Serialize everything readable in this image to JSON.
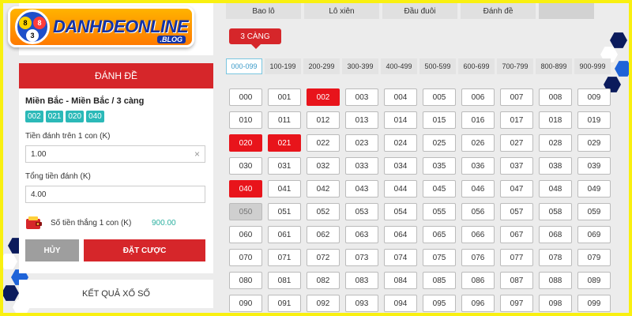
{
  "logo": {
    "text": "DANHDEONLINE",
    "sub": ".BLOG",
    "balls": [
      "8",
      "8",
      "3"
    ]
  },
  "form": {
    "header": "ĐÁNH ĐỀ",
    "bet_type": "Miền Bắc - Miền Bắc / 3 càng",
    "chips": [
      "002",
      "021",
      "020",
      "040"
    ],
    "amount_label": "Tiền đánh trên 1 con (K)",
    "amount_value": "1.00",
    "clear_symbol": "×",
    "total_label": "Tổng tiền đánh (K)",
    "total_value": "4.00",
    "win_label": "Số tiền thắng 1 con (K)",
    "win_value": "900.00",
    "cancel_label": "HỦY",
    "bet_label": "ĐẶT CƯỢC"
  },
  "results_label": "KẾT QUẢ XỔ SỐ",
  "tabs": [
    "Bao lô",
    "Lô xiên",
    "Đầu đuôi",
    "Đánh đề"
  ],
  "three_tag": "3 CÀNG",
  "ranges": [
    "000-099",
    "100-199",
    "200-299",
    "300-399",
    "400-499",
    "500-599",
    "600-699",
    "700-799",
    "800-899",
    "900-999"
  ],
  "active_range": 0,
  "numbers": [
    "000",
    "001",
    "002",
    "003",
    "004",
    "005",
    "006",
    "007",
    "008",
    "009",
    "010",
    "011",
    "012",
    "013",
    "014",
    "015",
    "016",
    "017",
    "018",
    "019",
    "020",
    "021",
    "022",
    "023",
    "024",
    "025",
    "026",
    "027",
    "028",
    "029",
    "030",
    "031",
    "032",
    "033",
    "034",
    "035",
    "036",
    "037",
    "038",
    "039",
    "040",
    "041",
    "042",
    "043",
    "044",
    "045",
    "046",
    "047",
    "048",
    "049",
    "050",
    "051",
    "052",
    "053",
    "054",
    "055",
    "056",
    "057",
    "058",
    "059",
    "060",
    "061",
    "062",
    "063",
    "064",
    "065",
    "066",
    "067",
    "068",
    "069",
    "070",
    "071",
    "072",
    "073",
    "074",
    "075",
    "076",
    "077",
    "078",
    "079",
    "080",
    "081",
    "082",
    "083",
    "084",
    "085",
    "086",
    "087",
    "088",
    "089",
    "090",
    "091",
    "092",
    "093",
    "094",
    "095",
    "096",
    "097",
    "098",
    "099"
  ],
  "selected": [
    "002",
    "020",
    "021",
    "040"
  ],
  "disabled": [
    "050"
  ],
  "colors": {
    "accent": "#d6262a",
    "selected": "#e8141b",
    "chip": "#2bb9b8",
    "frame": "#f9f010"
  }
}
